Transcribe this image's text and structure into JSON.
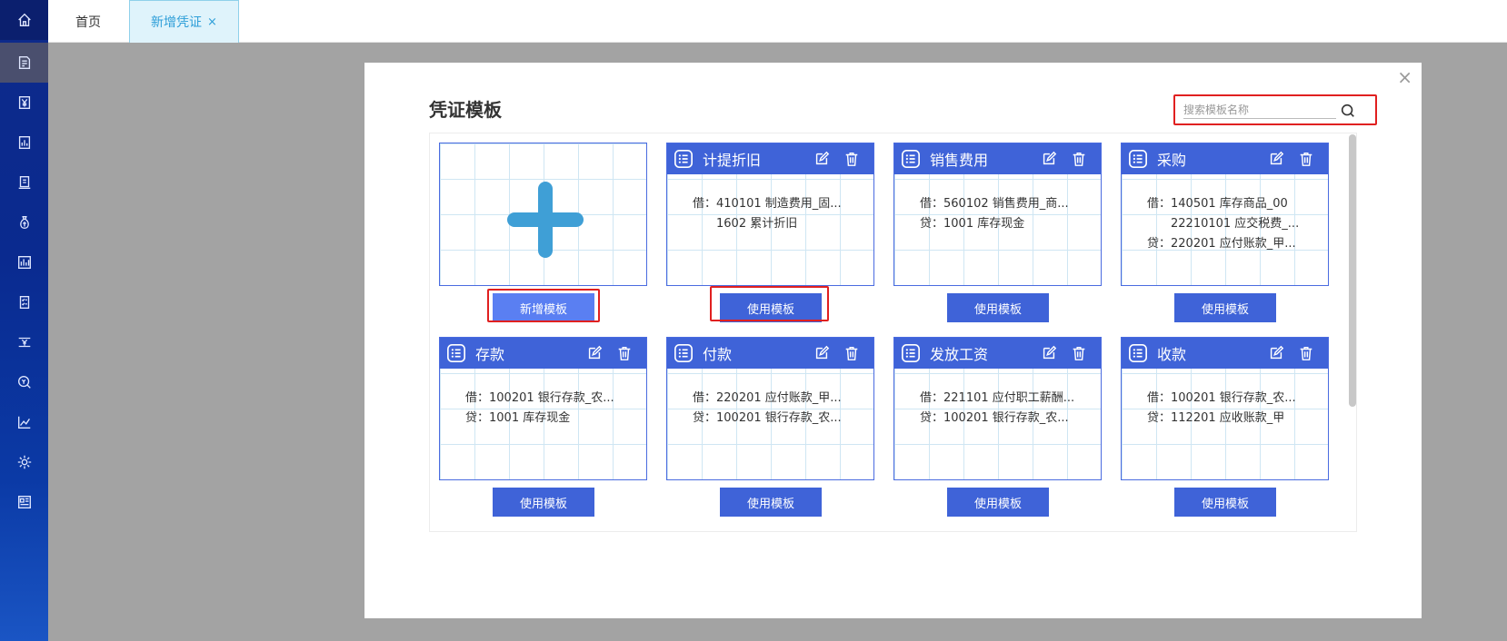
{
  "sidebar": {
    "items": [
      {
        "icon": "home-icon"
      },
      {
        "icon": "voucher-edit-icon"
      },
      {
        "icon": "yen-icon"
      },
      {
        "icon": "report-chart-icon"
      },
      {
        "icon": "ledger-icon"
      },
      {
        "icon": "money-bag-icon"
      },
      {
        "icon": "bar-chart-icon"
      },
      {
        "icon": "checklist-icon"
      },
      {
        "icon": "yen-transfer-icon"
      },
      {
        "icon": "search-money-icon"
      },
      {
        "icon": "trend-chart-icon"
      },
      {
        "icon": "gear-icon"
      },
      {
        "icon": "dashboard-icon"
      }
    ]
  },
  "tabs": {
    "home": "首页",
    "active": "新增凭证",
    "close": "×"
  },
  "modal": {
    "title": "凭证模板",
    "close": "×",
    "search_placeholder": "搜索模板名称",
    "add_button": "新增模板",
    "use_button": "使用模板",
    "templates": [
      {
        "name": "计提折旧",
        "lines": [
          "借：410101 制造费用_固...",
          "　　1602 累计折旧"
        ]
      },
      {
        "name": "销售费用",
        "lines": [
          "借：560102 销售费用_商...",
          "贷：1001 库存现金"
        ]
      },
      {
        "name": "采购",
        "lines": [
          "借：140501 库存商品_00",
          "　　22210101 应交税费_...",
          "贷：220201 应付账款_甲..."
        ]
      },
      {
        "name": "存款",
        "lines": [
          "借：100201 银行存款_农...",
          "贷：1001 库存现金"
        ]
      },
      {
        "name": "付款",
        "lines": [
          "借：220201 应付账款_甲...",
          "贷：100201 银行存款_农..."
        ]
      },
      {
        "name": "发放工资",
        "lines": [
          "借：221101 应付职工薪酬...",
          "贷：100201 银行存款_农..."
        ]
      },
      {
        "name": "收款",
        "lines": [
          "借：100201 银行存款_农...",
          "贷：112201 应收账款_甲"
        ]
      }
    ]
  },
  "colors": {
    "accent": "#3f63d8",
    "highlight": "#e02020",
    "sidebar": "#0e2a8a"
  }
}
